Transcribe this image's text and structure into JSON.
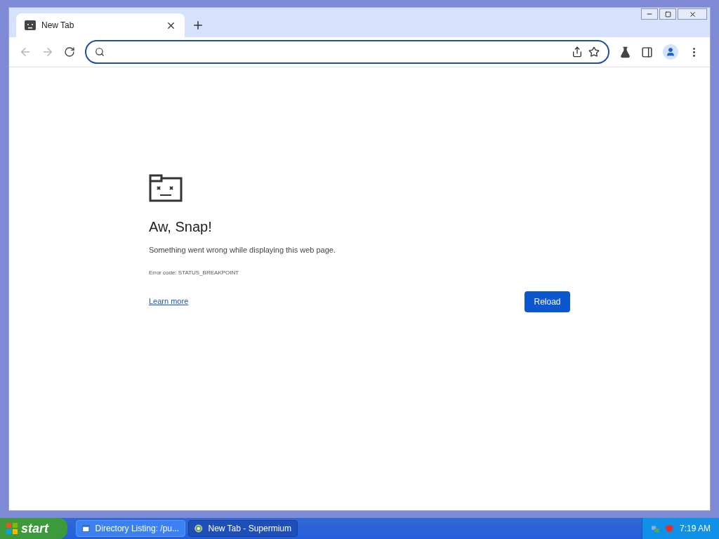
{
  "tabs": [
    {
      "title": "New Tab",
      "selected": true
    }
  ],
  "error": {
    "title": "Aw, Snap!",
    "message": "Something went wrong while displaying this web page.",
    "code": "Error code: STATUS_BREAKPOINT",
    "link": "Learn more",
    "button": "Reload"
  },
  "taskbar": {
    "start": "start",
    "tasks": [
      {
        "label": "Directory Listing: /pu...",
        "kind": "explorer",
        "selected": false
      },
      {
        "label": "New Tab - Supermium",
        "kind": "browser",
        "selected": true
      }
    ],
    "clock": "7:19 AM"
  }
}
